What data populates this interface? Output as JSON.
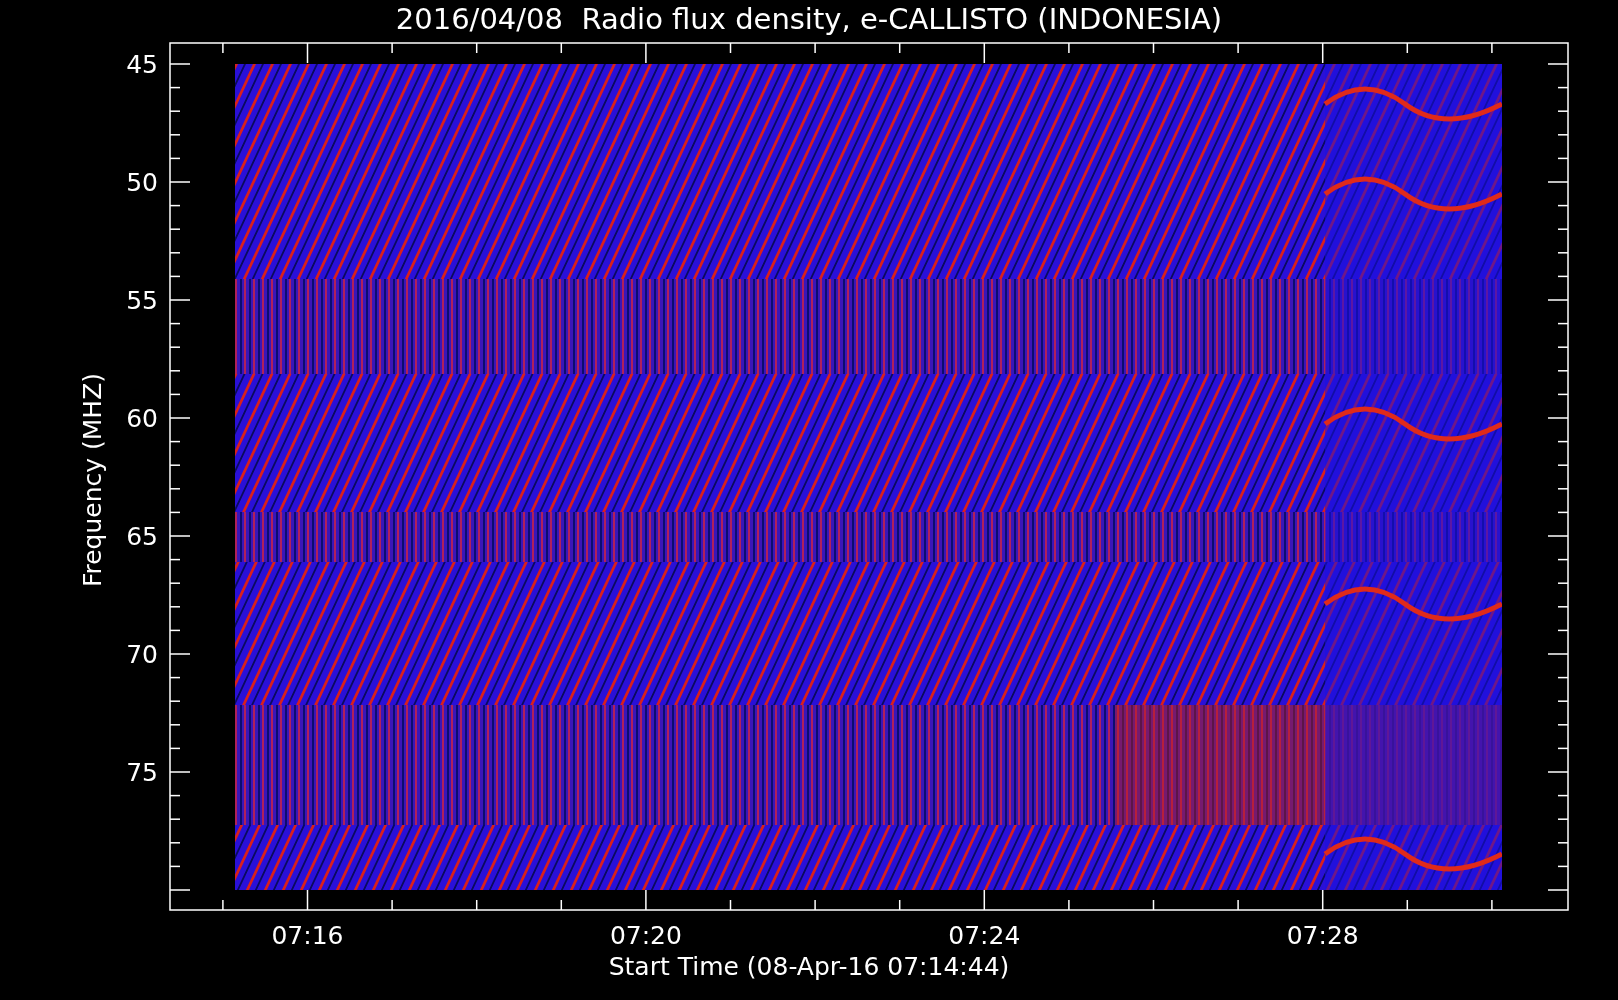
{
  "title": "2016/04/08  Radio flux density, e-CALLISTO (INDONESIA)",
  "y_axis": {
    "label": "Frequency (MHZ)",
    "ticks": [
      "45",
      "50",
      "55",
      "60",
      "65",
      "70",
      "75"
    ]
  },
  "x_axis": {
    "label": "Start Time (08-Apr-16 07:14:44)",
    "ticks": [
      "07:16",
      "07:20",
      "07:24",
      "07:28"
    ]
  }
}
